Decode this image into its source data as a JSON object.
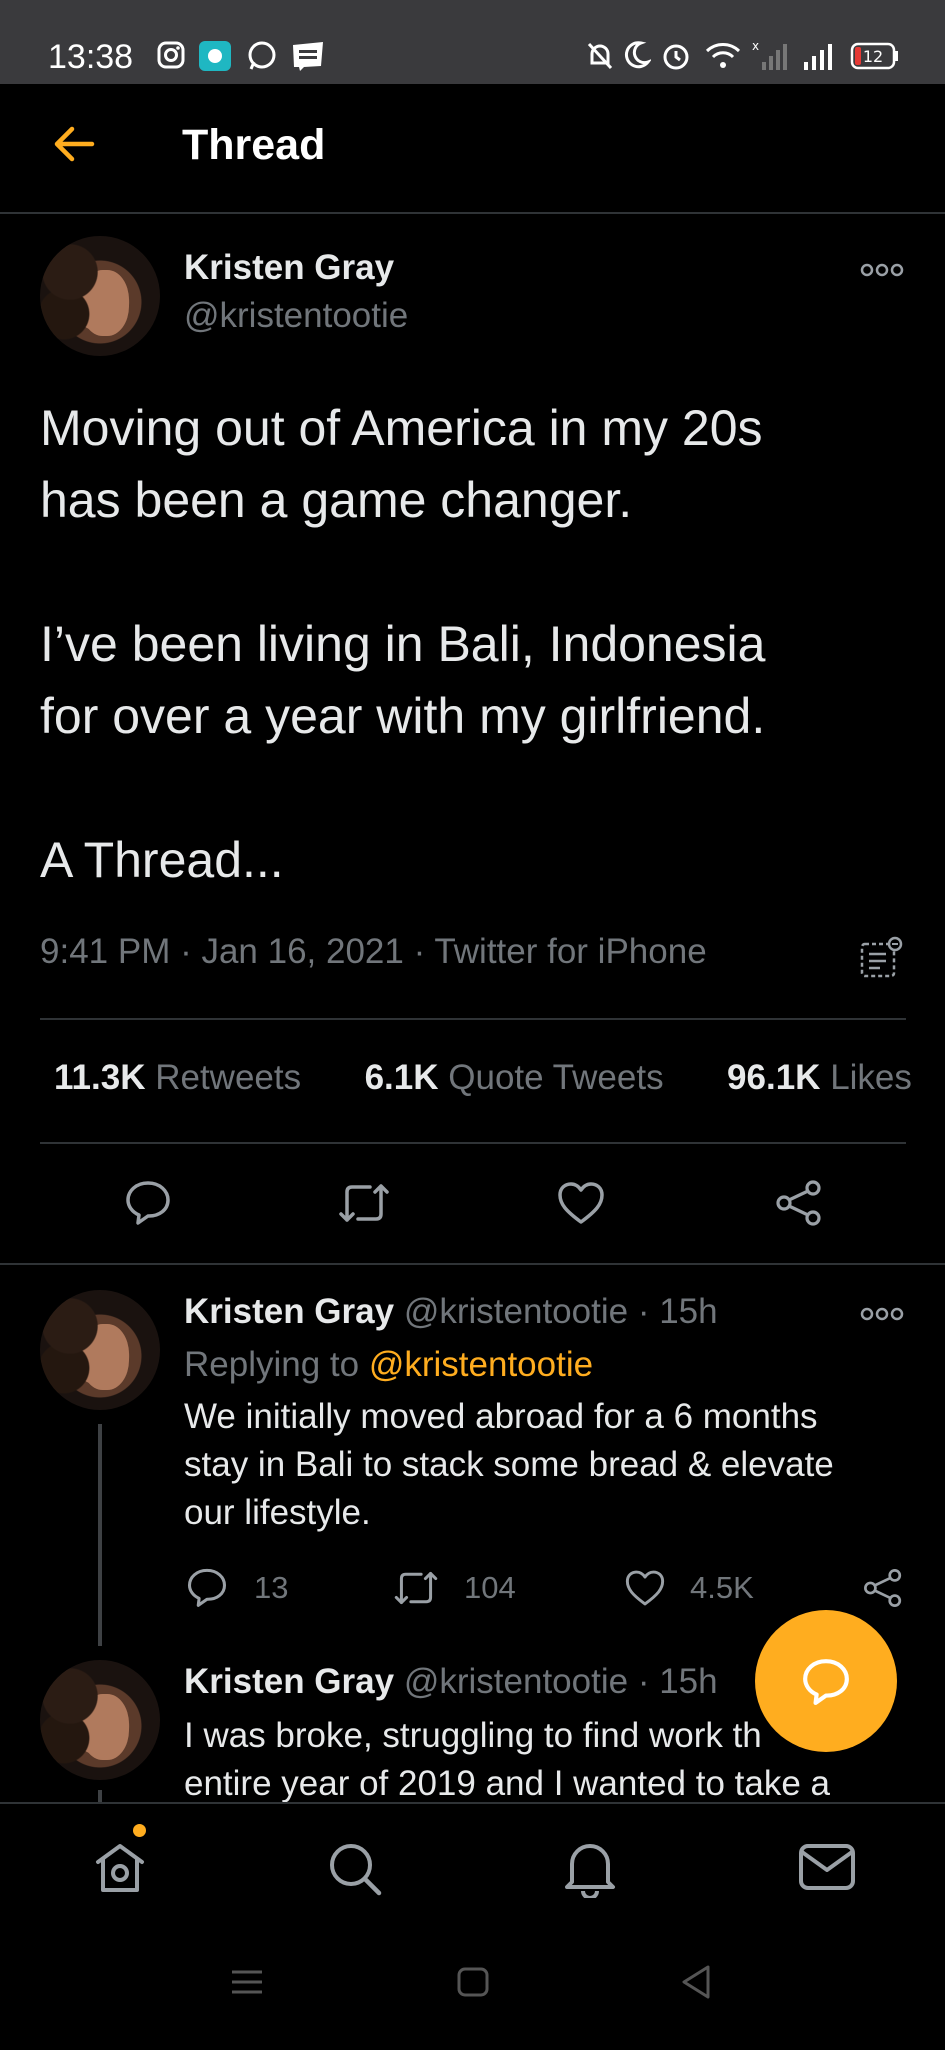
{
  "status_bar": {
    "time": "13:38",
    "battery": "12"
  },
  "header": {
    "title": "Thread"
  },
  "main_tweet": {
    "author_name": "Kristen Gray",
    "author_handle": "@kristentootie",
    "text": "Moving out of America in my 20s\nhas been a game changer.\n\nI’ve been living in Bali, Indonesia\nfor over a year with my girlfriend.\n\nA Thread...",
    "meta": "9:41 PM · Jan 16, 2021 · Twitter for iPhone",
    "stats": {
      "retweets_count": "11.3K",
      "retweets_label": "Retweets",
      "quotes_count": "6.1K",
      "quotes_label": "Quote Tweets",
      "likes_count": "96.1K",
      "likes_label": "Likes"
    }
  },
  "replies": [
    {
      "author_name": "Kristen Gray",
      "author_handle": "@kristentootie",
      "time": "· 15h",
      "replying_prefix": "Replying to",
      "replying_handle": "@kristentootie",
      "text_lines": [
        "We initially moved abroad for a 6 months",
        "stay in Bali to stack some bread & elevate",
        "our lifestyle."
      ],
      "replies_count": "13",
      "retweets_count": "104",
      "likes_count": "4.5K"
    },
    {
      "author_name": "Kristen Gray",
      "author_handle": "@kristentootie",
      "time": "· 15h",
      "text_lines": [
        "I was broke, struggling to find work th",
        "entire year of 2019 and I wanted to take a"
      ]
    }
  ],
  "colors": {
    "accent": "#ffad1f",
    "background": "#000000",
    "muted": "#71767b",
    "divider": "#2f3336"
  },
  "icons": [
    "back-arrow-icon",
    "more-options-icon",
    "reply-icon",
    "retweet-icon",
    "like-icon",
    "share-icon",
    "compose-reply-icon",
    "home-icon",
    "search-icon",
    "notifications-icon",
    "messages-icon"
  ]
}
